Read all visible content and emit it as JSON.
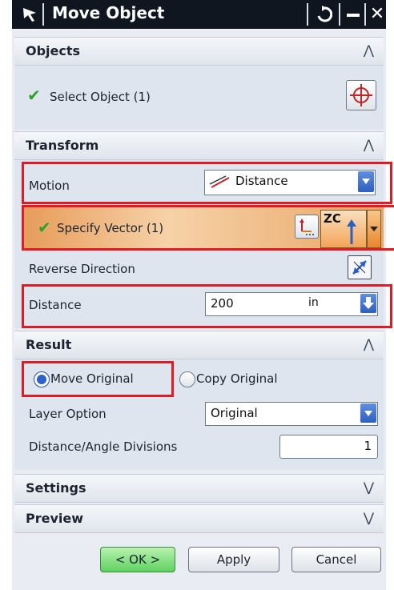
{
  "title": "Move Object",
  "sections": {
    "objects": "Objects",
    "transform": "Transform",
    "result": "Result",
    "settings": "Settings",
    "preview": "Preview"
  },
  "objects": {
    "select_label": "Select Object (1)"
  },
  "transform": {
    "motion_label": "Motion",
    "motion_value": "Distance",
    "vector_label": "Specify Vector (1)",
    "vector_axis": "ZC",
    "reverse_label": "Reverse Direction",
    "distance_label": "Distance",
    "distance_value": "200",
    "distance_unit": "in"
  },
  "result": {
    "move_original": "Move Original",
    "copy_original": "Copy Original",
    "selected": "Move Original",
    "layer_label": "Layer Option",
    "layer_value": "Original",
    "divisions_label": "Distance/Angle Divisions",
    "divisions_value": "1"
  },
  "buttons": {
    "ok": "< OK >",
    "apply": "Apply",
    "cancel": "Cancel"
  },
  "colors": {
    "highlight_red": "#e01b24",
    "accent_orange": "#f0a050",
    "check_green": "#29a329"
  }
}
